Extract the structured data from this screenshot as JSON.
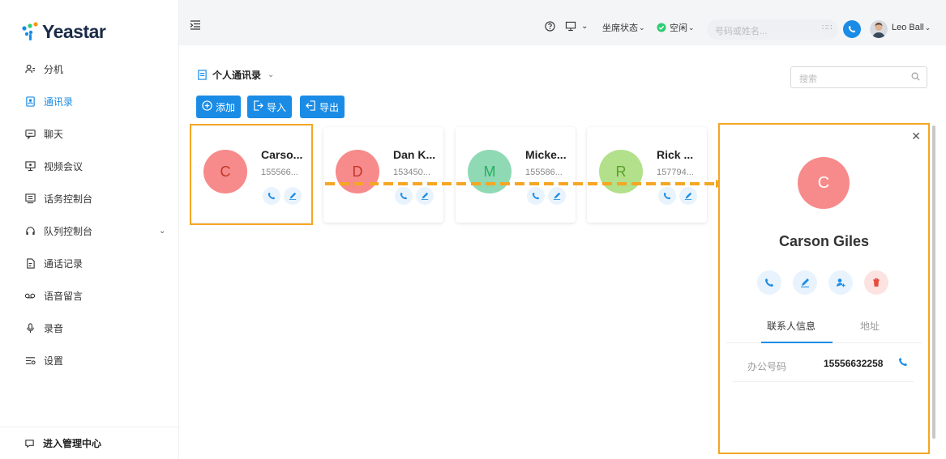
{
  "brand": {
    "name": "Yeastar"
  },
  "sidebar": {
    "items": [
      {
        "label": "分机",
        "icon": "extension-icon"
      },
      {
        "label": "通讯录",
        "icon": "contacts-icon",
        "active": true
      },
      {
        "label": "聊天",
        "icon": "chat-icon"
      },
      {
        "label": "视频会议",
        "icon": "video-conference-icon"
      },
      {
        "label": "话务控制台",
        "icon": "operator-panel-icon"
      },
      {
        "label": "队列控制台",
        "icon": "queue-panel-icon",
        "expandable": true
      },
      {
        "label": "通话记录",
        "icon": "call-log-icon"
      },
      {
        "label": "语音留言",
        "icon": "voicemail-icon"
      },
      {
        "label": "录音",
        "icon": "recording-icon"
      },
      {
        "label": "设置",
        "icon": "settings-icon"
      }
    ],
    "admin_label": "进入管理中心"
  },
  "topbar": {
    "agent_status_label": "坐席状态",
    "presence_label": "空闲",
    "search_placeholder": "号码或姓名...",
    "user_name": "Leo Ball"
  },
  "content": {
    "phonebook_label": "个人通讯录",
    "search_placeholder": "搜索",
    "buttons": {
      "add": "添加",
      "import": "导入",
      "export": "导出"
    },
    "contacts": [
      {
        "initial": "C",
        "name": "Carso...",
        "phone": "155566...",
        "color": "#f78a8a",
        "text_color": "#c0392b"
      },
      {
        "initial": "D",
        "name": "Dan K...",
        "phone": "153450...",
        "color": "#f78a8a",
        "text_color": "#c0392b"
      },
      {
        "initial": "M",
        "name": "Micke...",
        "phone": "155586...",
        "color": "#8fd9b4",
        "text_color": "#27ae60"
      },
      {
        "initial": "R",
        "name": "Rick ...",
        "phone": "157794...",
        "color": "#b3e08a",
        "text_color": "#5aa02c"
      }
    ]
  },
  "detail": {
    "initial": "C",
    "name": "Carson Giles",
    "tabs": {
      "info": "联系人信息",
      "address": "地址"
    },
    "fields": [
      {
        "label": "办公号码",
        "value": "15556632258"
      }
    ]
  },
  "colors": {
    "accent": "#1a8ce6",
    "highlight": "#f5a623",
    "danger": "#e74c3c"
  }
}
